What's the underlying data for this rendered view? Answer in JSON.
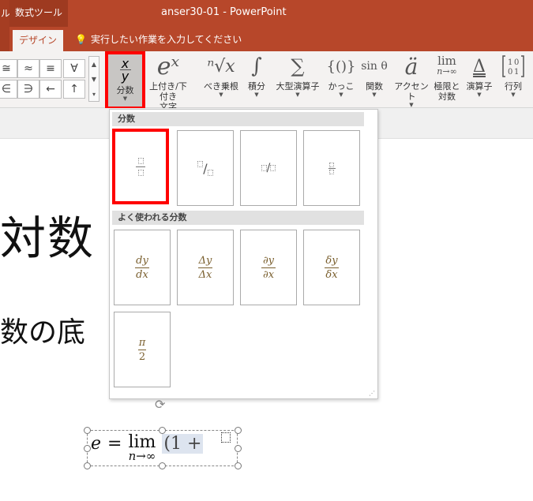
{
  "titlebar": {
    "left_label": "ル",
    "tool_label": "数式ツール",
    "title": "anser30-01  -  PowerPoint"
  },
  "tabs": {
    "design": "デザイン",
    "tell_me": "実行したい作業を入力してください"
  },
  "gallery_symbols": [
    "≅",
    "≈",
    "≡",
    "∀",
    "∈",
    "∋",
    "←",
    "↑"
  ],
  "ribbon": {
    "fraction": {
      "num": "x",
      "den": "y",
      "label": "分数"
    },
    "script": {
      "symbol": "eˣ",
      "label1": "上付き/下付き",
      "label2": "文字"
    },
    "radical": {
      "symbol": "ⁿ√x",
      "label": "べき乗根"
    },
    "integral": {
      "symbol": "∫",
      "label": "積分"
    },
    "large_op": {
      "symbol": "∑",
      "label": "大型演算子"
    },
    "bracket": {
      "symbol": "{()}",
      "label": "かっこ"
    },
    "function": {
      "symbol": "sin θ",
      "label": "関数"
    },
    "accent": {
      "symbol": "ä",
      "label": "アクセント"
    },
    "limit": {
      "symbol": "lim",
      "sub": "n→∞",
      "label1": "極限と",
      "label2": "対数"
    },
    "operator": {
      "symbol": "Δ",
      "label": "演算子"
    },
    "matrix": {
      "symbol": "[1 0 / 0 1]",
      "label": "行列"
    }
  },
  "dropdown": {
    "section1": "分数",
    "section2": "よく使われる分数",
    "common": [
      {
        "num": "dy",
        "den": "dx"
      },
      {
        "num": "Δy",
        "den": "Δx"
      },
      {
        "num": "∂y",
        "den": "∂x"
      },
      {
        "num": "δy",
        "den": "δx"
      },
      {
        "num": "π",
        "den": "2"
      }
    ]
  },
  "slide": {
    "line1": "対数",
    "line2": "数の底"
  },
  "equation": {
    "e": "e",
    "eq": "=",
    "lim": "lim",
    "sub": "n→∞",
    "paren": "(1 +",
    "close": ")"
  }
}
